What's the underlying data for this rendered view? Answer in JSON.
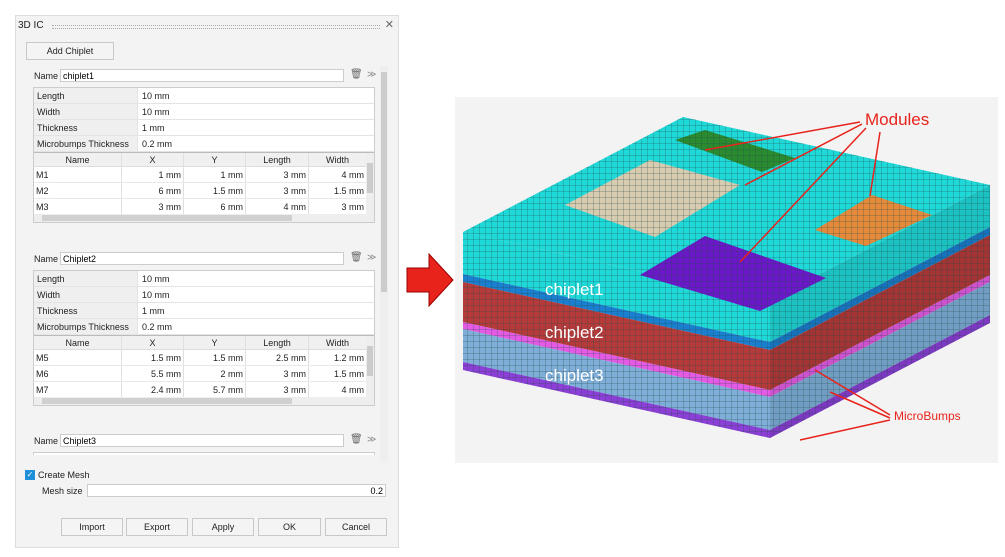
{
  "dialog": {
    "title": "3D IC",
    "close": "✕",
    "add_chiplet": "Add Chiplet"
  },
  "chiplets": [
    {
      "name_label": "Name",
      "name": "chiplet1",
      "props": [
        [
          "Length",
          "10 mm"
        ],
        [
          "Width",
          "10 mm"
        ],
        [
          "Thickness",
          "1 mm"
        ],
        [
          "Microbumps Thickness",
          "0.2 mm"
        ]
      ],
      "columns": [
        "Name",
        "X",
        "Y",
        "Length",
        "Width"
      ],
      "modules": [
        [
          "M1",
          "1 mm",
          "1 mm",
          "3 mm",
          "4 mm"
        ],
        [
          "M2",
          "6 mm",
          "1.5 mm",
          "3 mm",
          "1.5 mm"
        ],
        [
          "M3",
          "3 mm",
          "6 mm",
          "4 mm",
          "3 mm"
        ]
      ]
    },
    {
      "name_label": "Name",
      "name": "Chiplet2",
      "props": [
        [
          "Length",
          "10 mm"
        ],
        [
          "Width",
          "10 mm"
        ],
        [
          "Thickness",
          "1 mm"
        ],
        [
          "Microbumps Thickness",
          "0.2 mm"
        ]
      ],
      "columns": [
        "Name",
        "X",
        "Y",
        "Length",
        "Width"
      ],
      "modules": [
        [
          "M5",
          "1.5 mm",
          "1.5 mm",
          "2.5 mm",
          "1.2 mm"
        ],
        [
          "M6",
          "5.5 mm",
          "2 mm",
          "3 mm",
          "1.5 mm"
        ],
        [
          "M7",
          "2.4 mm",
          "5.7 mm",
          "3 mm",
          "4 mm"
        ]
      ]
    },
    {
      "name_label": "Name",
      "name": "Chiplet3"
    }
  ],
  "mesh": {
    "create_label": "Create Mesh",
    "checked": true,
    "size_label": "Mesh size",
    "size": "0.2"
  },
  "buttons": {
    "import": "Import",
    "export": "Export",
    "apply": "Apply",
    "ok": "OK",
    "cancel": "Cancel"
  },
  "figure": {
    "modules": "Modules",
    "microbumps": "MicroBumps",
    "layers": [
      "chiplet1",
      "chiplet2",
      "chiplet3"
    ]
  },
  "colors": {
    "arrow": "#e8231c",
    "cyan": "#1fd8d8",
    "blue": "#1b7fd0",
    "red": "#b53a3a",
    "magenta": "#e55ae5",
    "lightblue": "#7faed8",
    "purple": "#8b3fd6"
  }
}
